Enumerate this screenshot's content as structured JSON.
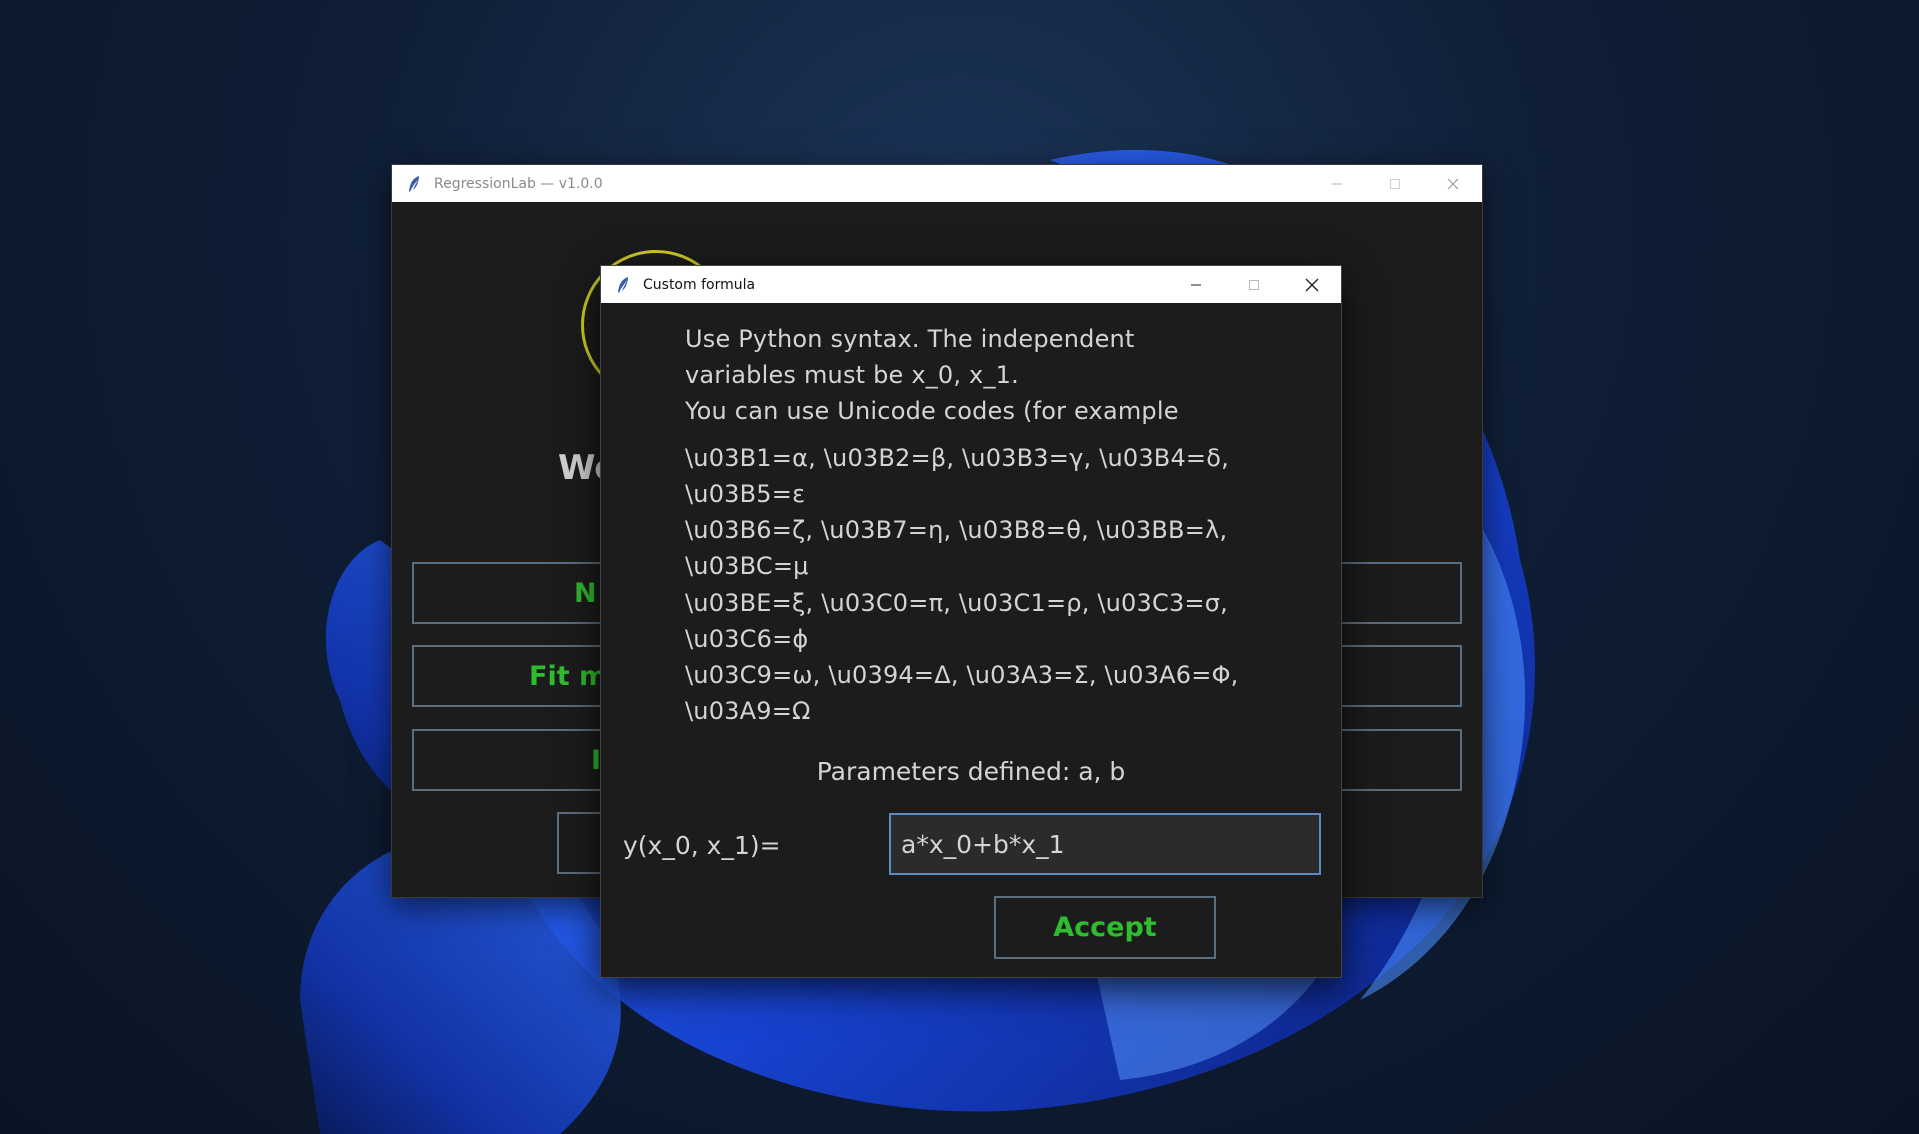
{
  "main_window": {
    "title": "RegressionLab — v1.0.0",
    "welcome_fragment": "We",
    "buttons": [
      {
        "label_fragment": "N"
      },
      {
        "label_fragment": "Fit m"
      },
      {
        "label_fragment": "I"
      }
    ]
  },
  "dialog": {
    "title": "Custom formula",
    "help_lines": [
      "Use Python syntax. The independent",
      "variables must be x_0, x_1.",
      "You can use Unicode codes (for example",
      "\\u03B1=α, \\u03B2=β, \\u03B3=γ, \\u03B4=δ,",
      "\\u03B5=ε",
      "\\u03B6=ζ, \\u03B7=η, \\u03B8=θ, \\u03BB=λ,",
      "\\u03BC=μ",
      "\\u03BE=ξ, \\u03C0=π, \\u03C1=ρ, \\u03C3=σ,",
      "\\u03C6=ϕ",
      "\\u03C9=ω, \\u0394=Δ, \\u03A3=Σ, \\u03A6=Φ,",
      "\\u03A9=Ω"
    ],
    "params_label": "Parameters defined: a, b",
    "formula_label": "y(x_0, x_1)=",
    "formula_value": "a*x_0+b*x_1",
    "accept_label": "Accept"
  },
  "colors": {
    "accent_green": "#2fbd2f",
    "logo_yellow": "#d4d028",
    "input_border": "#5b8bc2",
    "window_bg": "#1c1c1c"
  },
  "icons": {
    "app": "feather-icon",
    "minimize": "minimize-icon",
    "maximize": "maximize-icon",
    "close": "close-icon"
  }
}
